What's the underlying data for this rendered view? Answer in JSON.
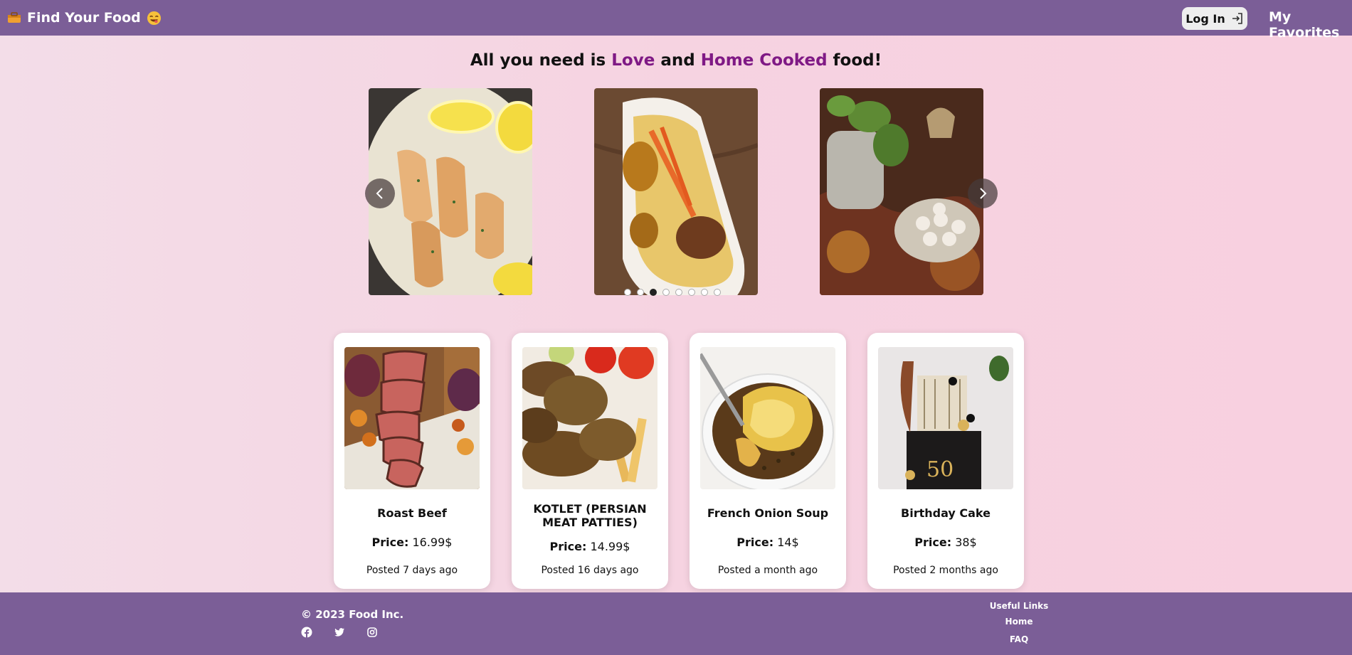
{
  "header": {
    "brand_title": "Find Your Food",
    "login_label": "Log In",
    "favorites_label": "My Favorites"
  },
  "hero": {
    "prefix": "All you need is ",
    "accent1": "Love",
    "middle": " and ",
    "accent2": "Home Cooked",
    "suffix": " food!"
  },
  "carousel": {
    "slides": [
      "salmon-lemon-cream",
      "rice-platter",
      "table-sweets"
    ],
    "dot_count": 8,
    "active_dot": 2
  },
  "cards": [
    {
      "title": "Roast Beef",
      "price_label": "Price:",
      "price": "16.99$",
      "posted": "Posted 7 days ago"
    },
    {
      "title": "KOTLET (PERSIAN MEAT PATTIES)",
      "price_label": "Price:",
      "price": "14.99$",
      "posted": "Posted 16 days ago"
    },
    {
      "title": "French Onion Soup",
      "price_label": "Price:",
      "price": "14$",
      "posted": "Posted a month ago"
    },
    {
      "title": "Birthday Cake",
      "price_label": "Price:",
      "price": "38$",
      "posted": "Posted 2 months ago"
    }
  ],
  "footer": {
    "copyright": "© 2023 Food Inc.",
    "socials": [
      "facebook-icon",
      "twitter-icon",
      "instagram-icon"
    ],
    "links_title": "Useful Links",
    "links": [
      "Home",
      "FAQ"
    ]
  },
  "colors": {
    "nav": "#7b5e97",
    "accent": "#7f1985"
  }
}
